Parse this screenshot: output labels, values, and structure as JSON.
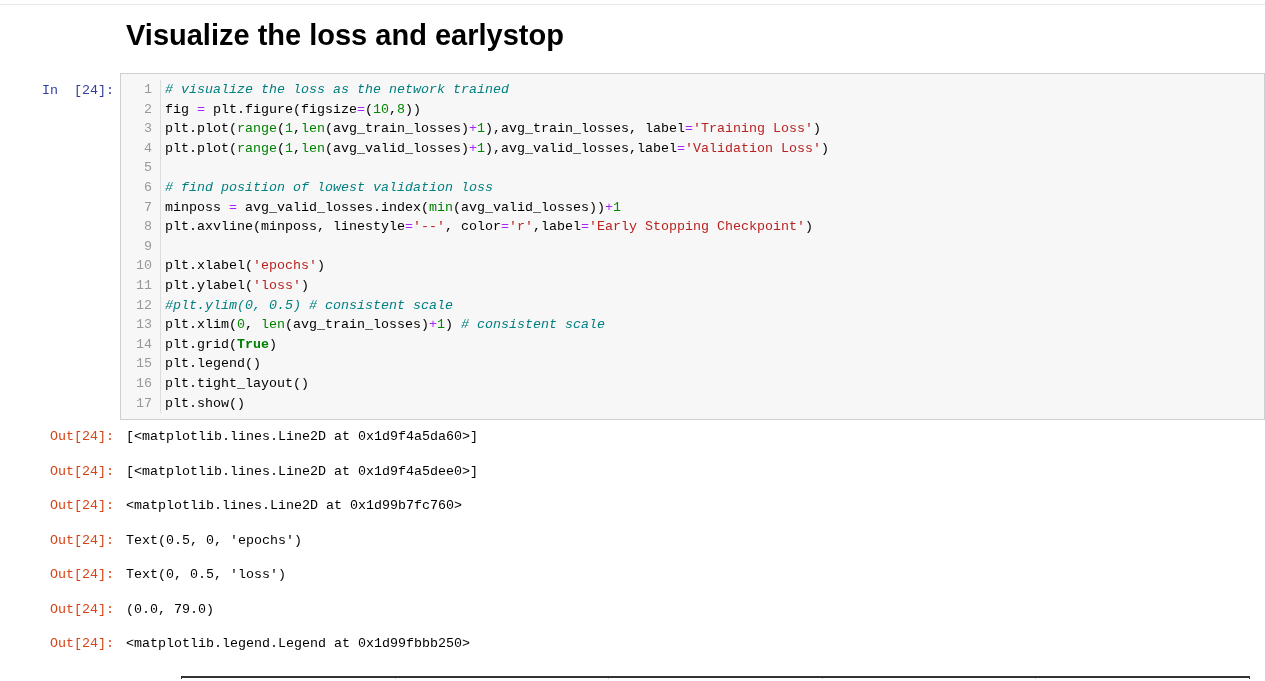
{
  "heading": "Visualize the loss and earlystop",
  "cell": {
    "prompt": "In  [24]:",
    "lines": [
      {
        "number": "1",
        "tokens": [
          {
            "kind": "comment",
            "text": "# visualize the loss as the network trained"
          }
        ]
      },
      {
        "number": "2",
        "tokens": [
          {
            "kind": "plain",
            "text": "fig "
          },
          {
            "kind": "op",
            "text": "="
          },
          {
            "kind": "plain",
            "text": " plt.figure(figsize"
          },
          {
            "kind": "op",
            "text": "="
          },
          {
            "kind": "plain",
            "text": "("
          },
          {
            "kind": "number",
            "text": "10"
          },
          {
            "kind": "plain",
            "text": ","
          },
          {
            "kind": "number",
            "text": "8"
          },
          {
            "kind": "plain",
            "text": "))"
          }
        ]
      },
      {
        "number": "3",
        "tokens": [
          {
            "kind": "plain",
            "text": "plt.plot("
          },
          {
            "kind": "builtin",
            "text": "range"
          },
          {
            "kind": "plain",
            "text": "("
          },
          {
            "kind": "number",
            "text": "1"
          },
          {
            "kind": "plain",
            "text": ","
          },
          {
            "kind": "builtin",
            "text": "len"
          },
          {
            "kind": "plain",
            "text": "(avg_train_losses)"
          },
          {
            "kind": "op",
            "text": "+"
          },
          {
            "kind": "number",
            "text": "1"
          },
          {
            "kind": "plain",
            "text": "),avg_train_losses, label"
          },
          {
            "kind": "op",
            "text": "="
          },
          {
            "kind": "string",
            "text": "'Training Loss'"
          },
          {
            "kind": "plain",
            "text": ")"
          }
        ]
      },
      {
        "number": "4",
        "tokens": [
          {
            "kind": "plain",
            "text": "plt.plot("
          },
          {
            "kind": "builtin",
            "text": "range"
          },
          {
            "kind": "plain",
            "text": "("
          },
          {
            "kind": "number",
            "text": "1"
          },
          {
            "kind": "plain",
            "text": ","
          },
          {
            "kind": "builtin",
            "text": "len"
          },
          {
            "kind": "plain",
            "text": "(avg_valid_losses)"
          },
          {
            "kind": "op",
            "text": "+"
          },
          {
            "kind": "number",
            "text": "1"
          },
          {
            "kind": "plain",
            "text": "),avg_valid_losses,label"
          },
          {
            "kind": "op",
            "text": "="
          },
          {
            "kind": "string",
            "text": "'Validation Loss'"
          },
          {
            "kind": "plain",
            "text": ")"
          }
        ]
      },
      {
        "number": "5"
      },
      {
        "number": "6",
        "tokens": [
          {
            "kind": "comment",
            "text": "# find position of lowest validation loss"
          }
        ]
      },
      {
        "number": "7",
        "tokens": [
          {
            "kind": "plain",
            "text": "minposs "
          },
          {
            "kind": "op",
            "text": "="
          },
          {
            "kind": "plain",
            "text": " avg_valid_losses.index("
          },
          {
            "kind": "builtin",
            "text": "min"
          },
          {
            "kind": "plain",
            "text": "(avg_valid_losses))"
          },
          {
            "kind": "op",
            "text": "+"
          },
          {
            "kind": "number",
            "text": "1"
          }
        ]
      },
      {
        "number": "8",
        "tokens": [
          {
            "kind": "plain",
            "text": "plt.axvline(minposs, linestyle"
          },
          {
            "kind": "op",
            "text": "="
          },
          {
            "kind": "string",
            "text": "'--'"
          },
          {
            "kind": "plain",
            "text": ", color"
          },
          {
            "kind": "op",
            "text": "="
          },
          {
            "kind": "string",
            "text": "'r'"
          },
          {
            "kind": "plain",
            "text": ",label"
          },
          {
            "kind": "op",
            "text": "="
          },
          {
            "kind": "string",
            "text": "'Early Stopping Checkpoint'"
          },
          {
            "kind": "plain",
            "text": ")"
          }
        ]
      },
      {
        "number": "9"
      },
      {
        "number": "10",
        "tokens": [
          {
            "kind": "plain",
            "text": "plt.xlabel("
          },
          {
            "kind": "string",
            "text": "'epochs'"
          },
          {
            "kind": "plain",
            "text": ")"
          }
        ]
      },
      {
        "number": "11",
        "tokens": [
          {
            "kind": "plain",
            "text": "plt.ylabel("
          },
          {
            "kind": "string",
            "text": "'loss'"
          },
          {
            "kind": "plain",
            "text": ")"
          }
        ]
      },
      {
        "number": "12",
        "tokens": [
          {
            "kind": "comment",
            "text": "#plt.ylim(0, 0.5) # consistent scale"
          }
        ]
      },
      {
        "number": "13",
        "tokens": [
          {
            "kind": "plain",
            "text": "plt.xlim("
          },
          {
            "kind": "number",
            "text": "0"
          },
          {
            "kind": "plain",
            "text": ", "
          },
          {
            "kind": "builtin",
            "text": "len"
          },
          {
            "kind": "plain",
            "text": "(avg_train_losses)"
          },
          {
            "kind": "op",
            "text": "+"
          },
          {
            "kind": "number",
            "text": "1"
          },
          {
            "kind": "plain",
            "text": ") "
          },
          {
            "kind": "comment",
            "text": "# consistent scale"
          }
        ]
      },
      {
        "number": "14",
        "tokens": [
          {
            "kind": "plain",
            "text": "plt.grid("
          },
          {
            "kind": "keyword",
            "text": "True"
          },
          {
            "kind": "plain",
            "text": ")"
          }
        ]
      },
      {
        "number": "15",
        "tokens": [
          {
            "kind": "plain",
            "text": "plt.legend()"
          }
        ]
      },
      {
        "number": "16",
        "tokens": [
          {
            "kind": "plain",
            "text": "plt.tight_layout()"
          }
        ]
      },
      {
        "number": "17",
        "tokens": [
          {
            "kind": "plain",
            "text": "plt.show()"
          }
        ]
      }
    ]
  },
  "outputs": [
    {
      "prompt": "Out[24]:",
      "text": "[<matplotlib.lines.Line2D at 0x1d9f4a5da60>]"
    },
    {
      "prompt": "Out[24]:",
      "text": "[<matplotlib.lines.Line2D at 0x1d9f4a5dee0>]"
    },
    {
      "prompt": "Out[24]:",
      "text": "<matplotlib.lines.Line2D at 0x1d99b7fc760>"
    },
    {
      "prompt": "Out[24]:",
      "text": "Text(0.5, 0, 'epochs')"
    },
    {
      "prompt": "Out[24]:",
      "text": "Text(0, 0.5, 'loss')"
    },
    {
      "prompt": "Out[24]:",
      "text": "(0.0, 79.0)"
    },
    {
      "prompt": "Out[24]:",
      "text": "<matplotlib.legend.Legend at 0x1d99fbbb250>"
    }
  ]
}
